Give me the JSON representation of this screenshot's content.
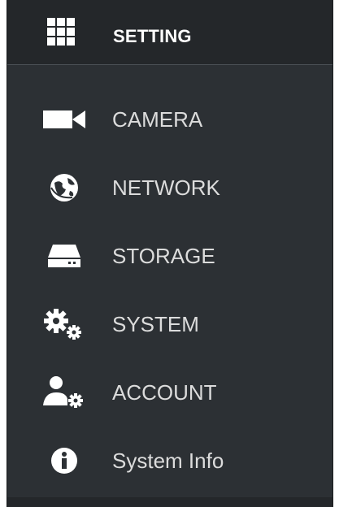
{
  "header": {
    "title": "SETTING",
    "icon": "grid-icon"
  },
  "menu": {
    "items": [
      {
        "label": "CAMERA",
        "icon": "camera-icon"
      },
      {
        "label": "NETWORK",
        "icon": "network-globe-icon"
      },
      {
        "label": "STORAGE",
        "icon": "hard-drive-icon"
      },
      {
        "label": "SYSTEM",
        "icon": "gears-icon"
      },
      {
        "label": "ACCOUNT",
        "icon": "user-gear-icon"
      },
      {
        "label": "System Info",
        "icon": "info-icon"
      }
    ]
  },
  "colors": {
    "panel": "#2c3034",
    "header": "#24272a",
    "text": "#dcdcdc",
    "icon": "#ffffff"
  }
}
